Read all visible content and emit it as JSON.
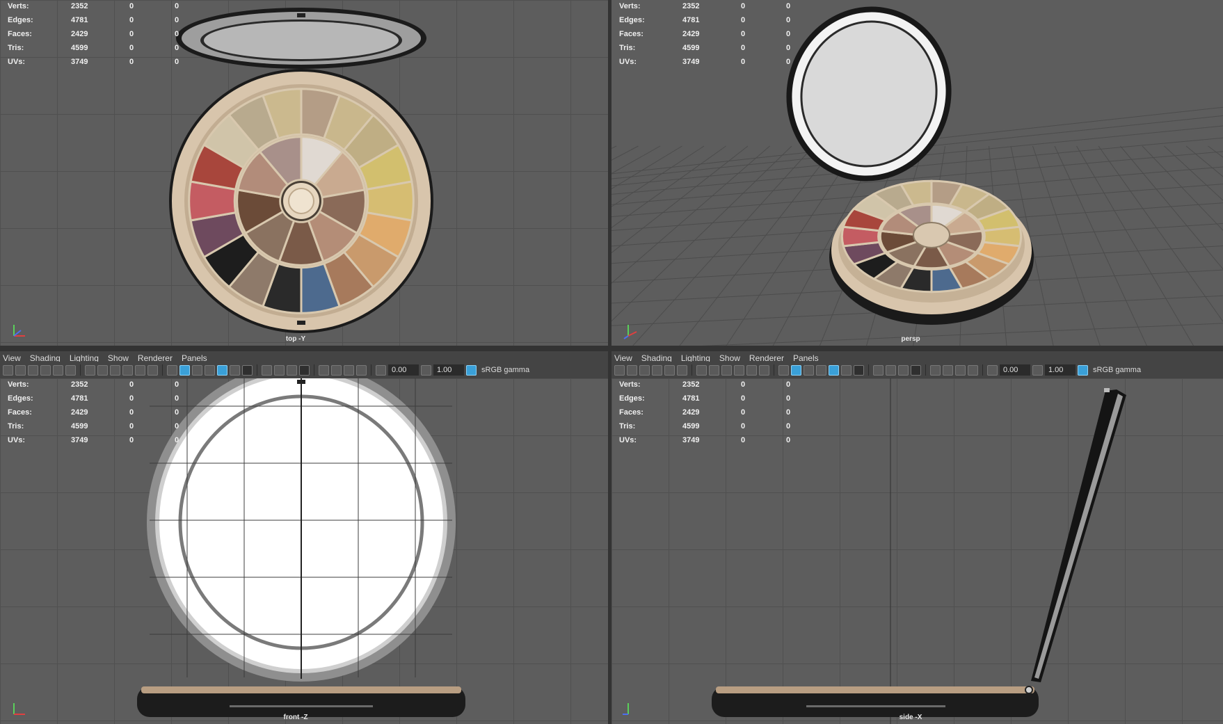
{
  "hud_stats": [
    {
      "label": "Verts:",
      "v1": "2352",
      "v2": "0",
      "v3": "0"
    },
    {
      "label": "Edges:",
      "v1": "4781",
      "v2": "0",
      "v3": "0"
    },
    {
      "label": "Faces:",
      "v1": "2429",
      "v2": "0",
      "v3": "0"
    },
    {
      "label": "Tris:",
      "v1": "4599",
      "v2": "0",
      "v3": "0"
    },
    {
      "label": "UVs:",
      "v1": "3749",
      "v2": "0",
      "v3": "0"
    }
  ],
  "viewports": {
    "top": {
      "camera": "top -Y"
    },
    "persp": {
      "camera": "persp"
    },
    "front": {
      "camera": "front -Z"
    },
    "side": {
      "camera": "side -X"
    }
  },
  "panel_menu": [
    "View",
    "Shading",
    "Lighting",
    "Show",
    "Renderer",
    "Panels"
  ],
  "panel_toolbar": {
    "exposure": "0.00",
    "gamma": "1.00",
    "color_space": "sRGB gamma"
  },
  "colors": {
    "viewport_bg": "#5d5d5d",
    "grid_line": "#505050",
    "toolbar_bg": "#444444",
    "highlight": "#3aa0d8",
    "palette_case": "#d8c5ac",
    "mirror": "#e8e8e8"
  }
}
